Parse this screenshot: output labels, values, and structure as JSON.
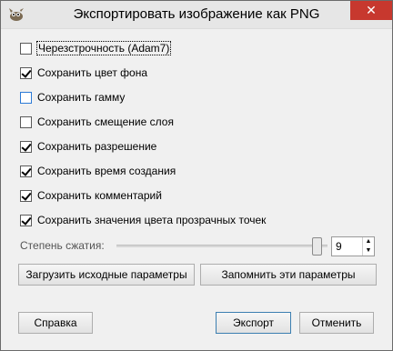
{
  "window": {
    "title": "Экспортировать изображение как PNG",
    "close_glyph": "✕"
  },
  "options": [
    {
      "label": "Черезстрочность (Adam7)",
      "checked": false
    },
    {
      "label": "Сохранить цвет фона",
      "checked": true
    },
    {
      "label": "Сохранить гамму",
      "checked": false
    },
    {
      "label": "Сохранить смещение слоя",
      "checked": false
    },
    {
      "label": "Сохранить разрешение",
      "checked": true
    },
    {
      "label": "Сохранить время создания",
      "checked": true
    },
    {
      "label": "Сохранить комментарий",
      "checked": true
    },
    {
      "label": "Сохранить значения цвета прозрачных точек",
      "checked": true
    }
  ],
  "compression": {
    "label": "Степень сжатия:",
    "value": "9",
    "max": 9
  },
  "buttons": {
    "load_defaults": "Загрузить исходные параметры",
    "save_defaults": "Запомнить эти параметры",
    "help": "Справка",
    "export": "Экспорт",
    "cancel": "Отменить"
  },
  "colors": {
    "close_button": "#c7382e",
    "focus_border": "#2c7ad6",
    "default_button_border": "#3c7fb1"
  }
}
